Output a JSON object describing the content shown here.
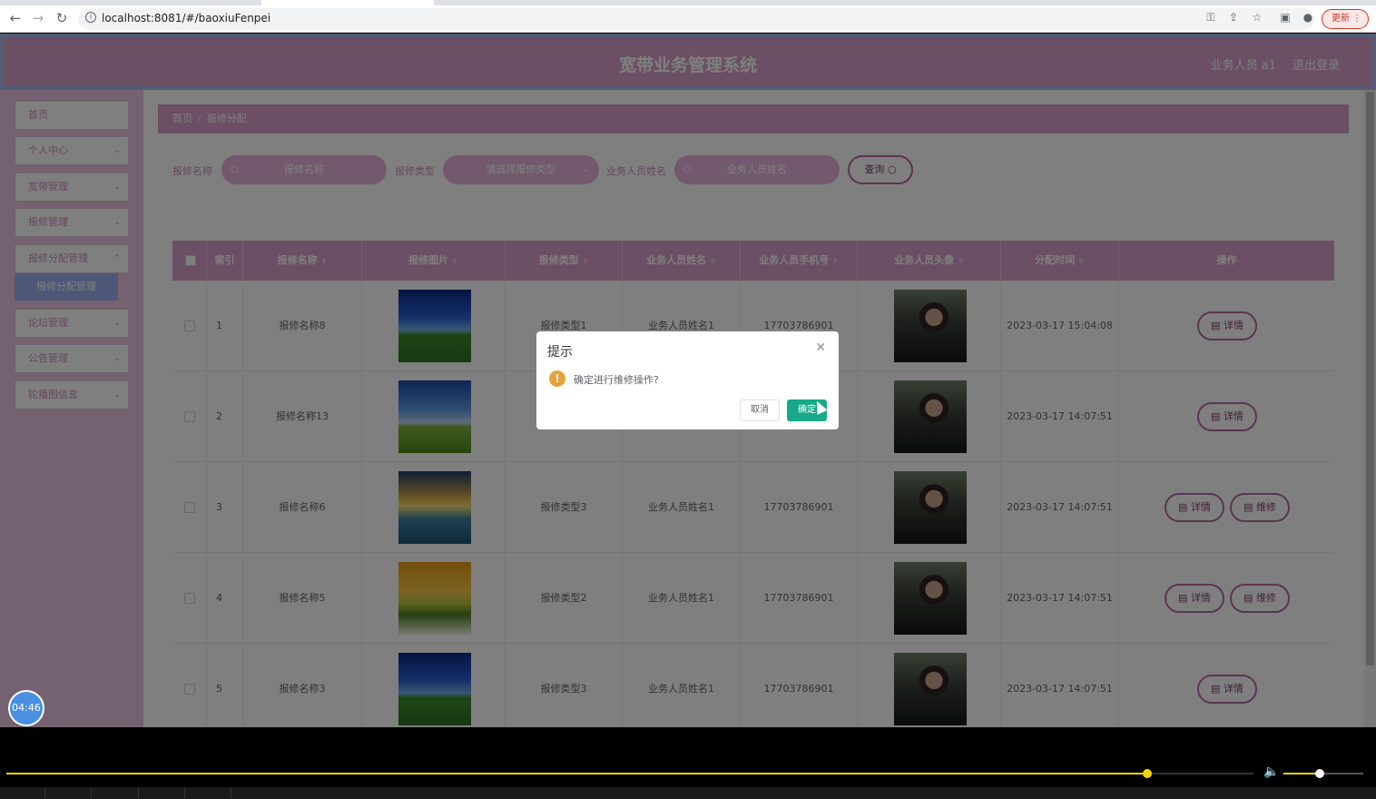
{
  "browser": {
    "url": "localhost:8081/#/baoxiuFenpei",
    "update_label": "更新"
  },
  "header": {
    "title": "宽带业务管理系统",
    "user": "业务人员 a1",
    "logout": "退出登录"
  },
  "sidebar": {
    "items": [
      {
        "label": "首页"
      },
      {
        "label": "个人中心"
      },
      {
        "label": "宽带管理"
      },
      {
        "label": "报修管理"
      },
      {
        "label": "报修分配管理"
      },
      {
        "label": "论坛管理"
      },
      {
        "label": "公告管理"
      },
      {
        "label": "轮播图信息"
      }
    ],
    "sub_item": "报修分配管理"
  },
  "breadcrumb": {
    "home": "首页",
    "current": "报修分配"
  },
  "search": {
    "name_label": "报修名称",
    "name_placeholder": "报修名称",
    "type_label": "报修类型",
    "type_placeholder": "请选择报修类型",
    "staff_label": "业务人员姓名",
    "staff_placeholder": "业务人员姓名",
    "query_label": "查询"
  },
  "table": {
    "columns": [
      "索引",
      "报修名称",
      "报修图片",
      "报修类型",
      "业务人员姓名",
      "业务人员手机号",
      "业务人员头像",
      "分配时间",
      "操作"
    ],
    "rows": [
      {
        "index": "1",
        "name": "报修名称8",
        "type": "报修类型1",
        "staff": "业务人员姓名1",
        "phone": "17703786901",
        "time": "2023-03-17 15:04:08",
        "actions": [
          "详情"
        ]
      },
      {
        "index": "2",
        "name": "报修名称13",
        "type": "",
        "staff": "",
        "phone": "",
        "time": "2023-03-17 14:07:51",
        "actions": [
          "详情"
        ]
      },
      {
        "index": "3",
        "name": "报修名称6",
        "type": "报修类型3",
        "staff": "业务人员姓名1",
        "phone": "17703786901",
        "time": "2023-03-17 14:07:51",
        "actions": [
          "详情",
          "维修"
        ]
      },
      {
        "index": "4",
        "name": "报修名称5",
        "type": "报修类型2",
        "staff": "业务人员姓名1",
        "phone": "17703786901",
        "time": "2023-03-17 14:07:51",
        "actions": [
          "详情",
          "维修"
        ]
      },
      {
        "index": "5",
        "name": "报修名称3",
        "type": "报修类型3",
        "staff": "业务人员姓名1",
        "phone": "17703786901",
        "time": "2023-03-17 14:07:51",
        "actions": [
          "详情"
        ]
      }
    ]
  },
  "dialog": {
    "title": "提示",
    "message": "确定进行维修操作?",
    "cancel": "取消",
    "confirm": "确定"
  },
  "timer": "04:46",
  "player": {
    "progress": 0.915,
    "volume": 0.45
  },
  "colors": {
    "primary": "#d69ec8",
    "accent_button": "#17a98a",
    "warning": "#e6a23c",
    "progress": "#f3d500"
  }
}
